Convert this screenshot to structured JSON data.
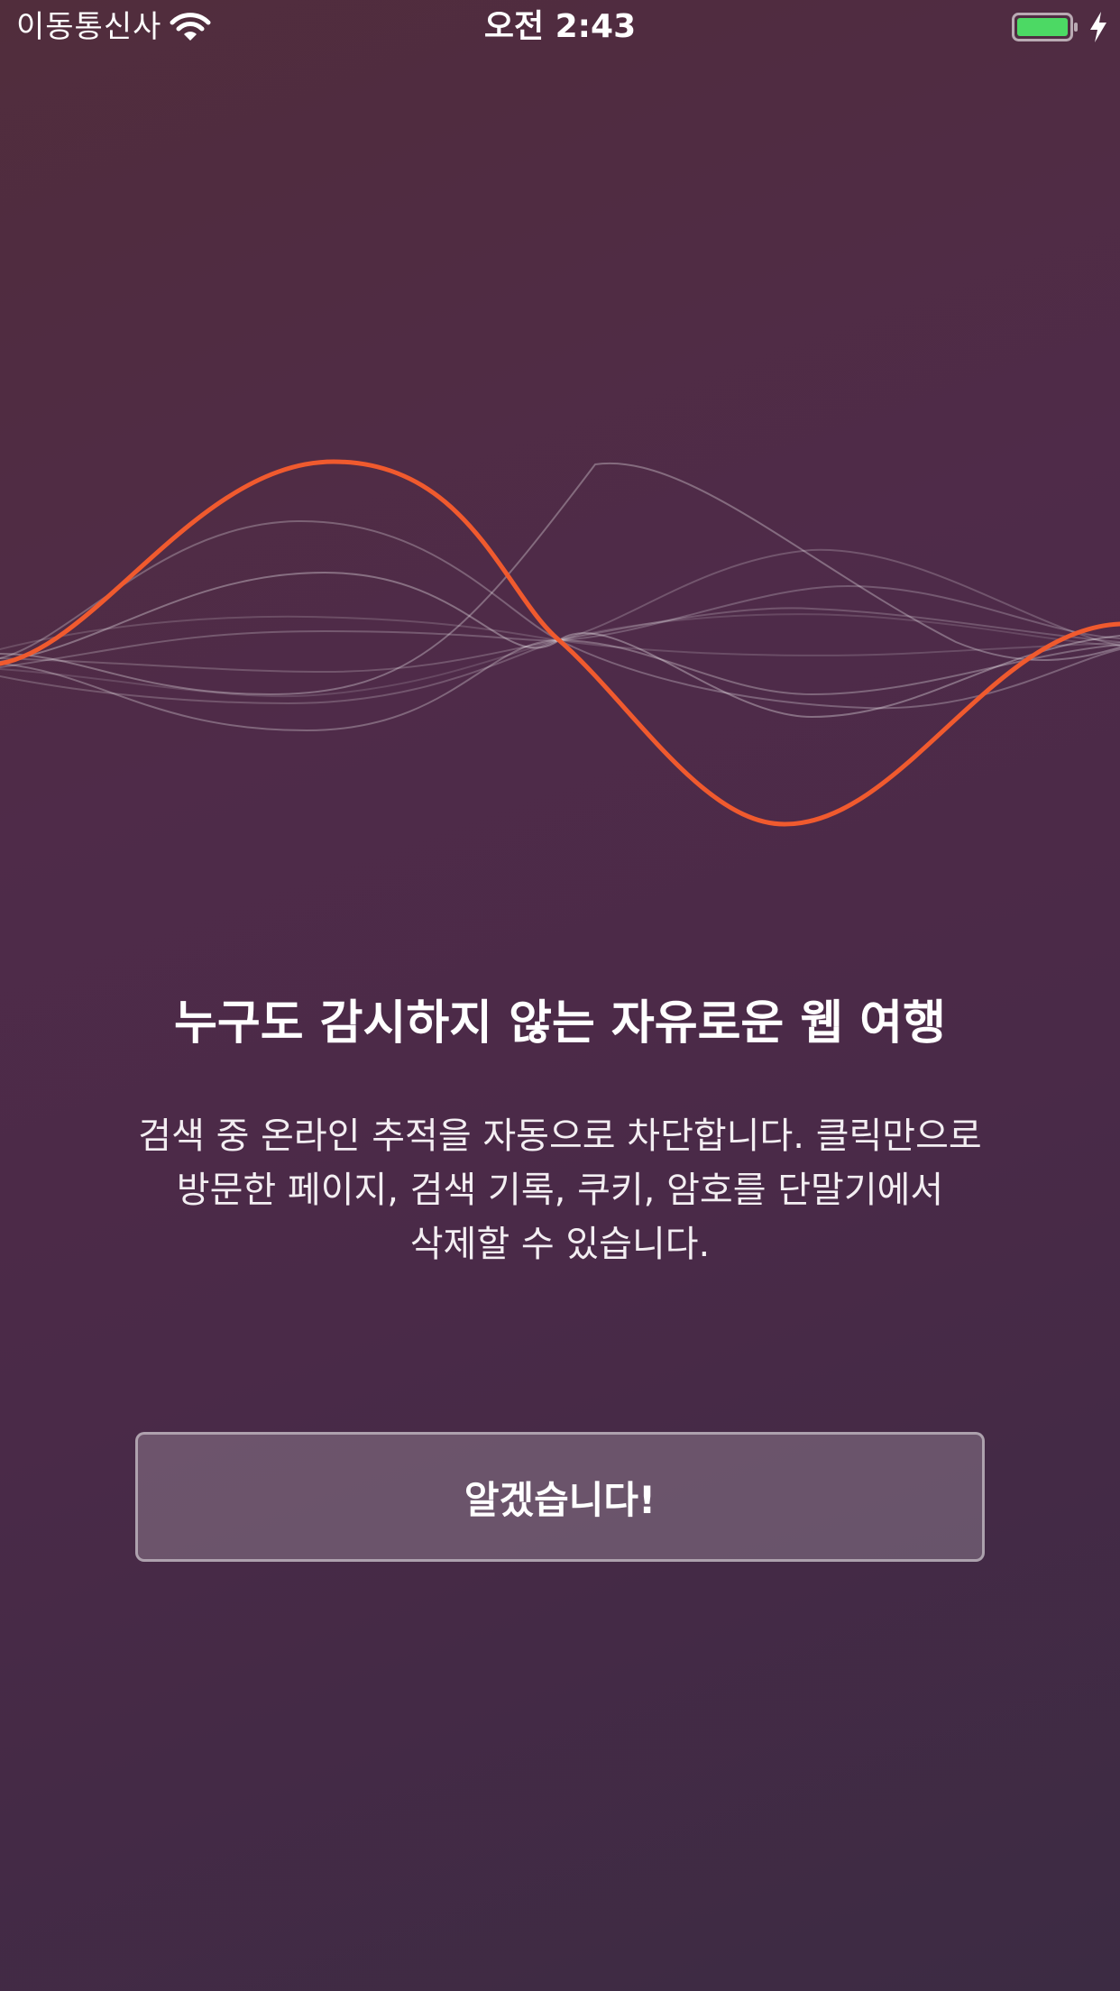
{
  "status_bar": {
    "carrier": "이동통신사",
    "time": "오전 2:43",
    "wifi_icon": "wifi-icon",
    "battery_icon": "battery-full-icon",
    "charging_icon": "charging-bolt-icon",
    "battery_color": "#4cd964"
  },
  "graphic": {
    "icon": "sound-wave-graphic",
    "accent_color": "#f05a2e"
  },
  "onboarding": {
    "headline": "누구도 감시하지 않는 자유로운 웹 여행",
    "description_lines": [
      "검색 중 온라인 추적을 자동으로 차단합니다. 클릭만으로",
      "방문한 페이지, 검색 기록, 쿠키, 암호를 단말기에서",
      "삭제할 수 있습니다."
    ],
    "confirm_label": "알겠습니다!"
  }
}
